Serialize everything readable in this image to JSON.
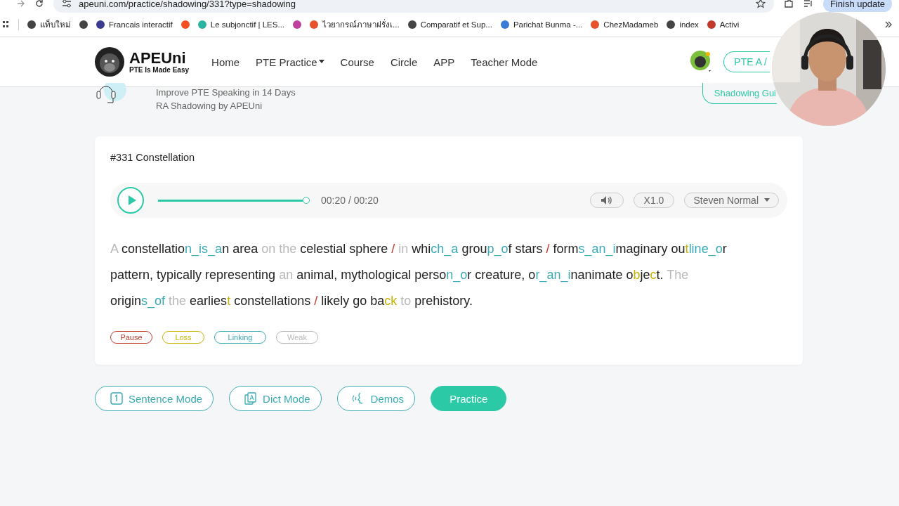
{
  "browser": {
    "url": "apeuni.com/practice/shadowing/331?type=shadowing",
    "update_button": "Finish update",
    "bookmarks": [
      {
        "label": "แท็บใหม่",
        "color": "#444444"
      },
      {
        "color": "#444444"
      },
      {
        "label": "Francais interactif",
        "color": "#3b3b8f"
      },
      {
        "color": "#f25022"
      },
      {
        "label": "Le subjonctif | LES...",
        "color": "#2bb5a0"
      },
      {
        "color": "#c040a0"
      },
      {
        "label": "ไวยากรณ์ภาษาฝรั่งเ...",
        "color": "#e8542a"
      },
      {
        "label": "Comparatif et Sup...",
        "color": "#444444"
      },
      {
        "label": "Parichat Bunma -...",
        "color": "#3a7bd5"
      },
      {
        "label": "ChezMadameb",
        "color": "#e8542a"
      },
      {
        "label": "index",
        "color": "#444444"
      },
      {
        "label": "Activi",
        "color": "#c0392b"
      }
    ]
  },
  "header": {
    "logo": {
      "title": "APEUni",
      "tagline": "PTE Is Made Easy"
    },
    "nav": [
      {
        "label": "Home",
        "dropdown": false
      },
      {
        "label": "PTE Practice",
        "dropdown": true
      },
      {
        "label": "Course",
        "dropdown": false
      },
      {
        "label": "Circle",
        "dropdown": false
      },
      {
        "label": "APP",
        "dropdown": false
      },
      {
        "label": "Teacher Mode",
        "dropdown": false
      }
    ],
    "plan_button": "PTE A /"
  },
  "banner": {
    "lines": [
      "Improve PTE Speaking in 14 Days",
      "RA Shadowing by APEUni"
    ],
    "guide_button": "Shadowing Gui"
  },
  "card": {
    "title": "#331 Constellation",
    "player": {
      "level": 1,
      "time": "00:20 / 00:20",
      "speed": "X1.0",
      "voice": "Steven Normal"
    },
    "segments": [
      {
        "text": "A ",
        "kind": "weak"
      },
      {
        "text": "constellatio",
        "kind": "normal"
      },
      {
        "text": "n_is_a",
        "kind": "linking"
      },
      {
        "text": "n area ",
        "kind": "normal"
      },
      {
        "text": "on the ",
        "kind": "weak"
      },
      {
        "text": "celestial sphere ",
        "kind": "normal"
      },
      {
        "text": "/ ",
        "kind": "pause"
      },
      {
        "text": "in ",
        "kind": "weak"
      },
      {
        "text": "whi",
        "kind": "normal"
      },
      {
        "text": "ch_a",
        "kind": "linking"
      },
      {
        "text": " grou",
        "kind": "normal"
      },
      {
        "text": "p_o",
        "kind": "linking"
      },
      {
        "text": "f stars ",
        "kind": "normal"
      },
      {
        "text": "/ ",
        "kind": "pause"
      },
      {
        "text": "form",
        "kind": "normal"
      },
      {
        "text": "s_an_i",
        "kind": "linking"
      },
      {
        "text": "maginary ou",
        "kind": "normal"
      },
      {
        "text": "t",
        "kind": "loss"
      },
      {
        "text": "line_o",
        "kind": "linking"
      },
      {
        "text": "r pattern, typically representing ",
        "kind": "normal"
      },
      {
        "text": "an ",
        "kind": "weak"
      },
      {
        "text": "animal, mythological perso",
        "kind": "normal"
      },
      {
        "text": "n_o",
        "kind": "linking"
      },
      {
        "text": "r creature, o",
        "kind": "normal"
      },
      {
        "text": "r_an_i",
        "kind": "linking"
      },
      {
        "text": "nanimate o",
        "kind": "normal"
      },
      {
        "text": "b",
        "kind": "loss"
      },
      {
        "text": "je",
        "kind": "normal"
      },
      {
        "text": "c",
        "kind": "loss"
      },
      {
        "text": "t. ",
        "kind": "normal"
      },
      {
        "text": "The ",
        "kind": "weak"
      },
      {
        "text": "origin",
        "kind": "normal"
      },
      {
        "text": "s_of",
        "kind": "linking"
      },
      {
        "text": " the ",
        "kind": "weak"
      },
      {
        "text": "earlies",
        "kind": "normal"
      },
      {
        "text": "t",
        "kind": "loss"
      },
      {
        "text": " constellations ",
        "kind": "normal"
      },
      {
        "text": "/ ",
        "kind": "pause"
      },
      {
        "text": "likely go ba",
        "kind": "normal"
      },
      {
        "text": "ck",
        "kind": "loss"
      },
      {
        "text": " to ",
        "kind": "weak"
      },
      {
        "text": "prehistory.",
        "kind": "normal"
      }
    ],
    "legend": [
      {
        "label": "Pause",
        "kind": "pause"
      },
      {
        "label": "Loss",
        "kind": "loss"
      },
      {
        "label": "Linking",
        "kind": "linking"
      },
      {
        "label": "Weak",
        "kind": "weak"
      }
    ]
  },
  "actions": [
    {
      "label": "Sentence Mode",
      "kind": "sentence",
      "primary": false
    },
    {
      "label": "Dict Mode",
      "kind": "dict",
      "primary": false
    },
    {
      "label": "Demos",
      "kind": "demos",
      "primary": false
    },
    {
      "label": "Practice",
      "kind": "practice",
      "primary": true
    }
  ]
}
